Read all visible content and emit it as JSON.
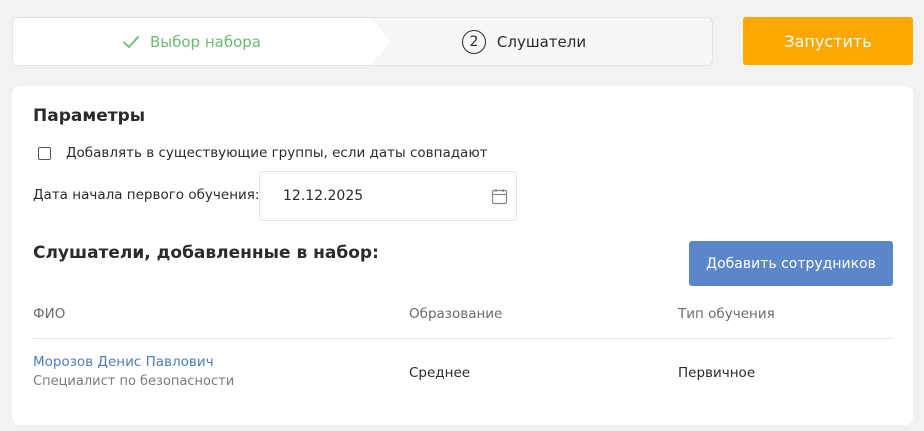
{
  "stepper": {
    "steps": [
      {
        "label": "Выбор набора",
        "state": "done"
      },
      {
        "number": "2",
        "label": "Слушатели",
        "state": "active"
      }
    ]
  },
  "run_button": {
    "label": "Запустить"
  },
  "params": {
    "title": "Параметры",
    "checkbox_label": "Добавлять в существующие группы, если даты совпадают",
    "checkbox_checked": false,
    "date_label": "Дата начала первого обучения:",
    "date_value": "12.12.2025"
  },
  "listeners": {
    "title": "Слушатели, добавленные в набор:",
    "add_button": "Добавить сотрудников",
    "columns": [
      "ФИО",
      "Образование",
      "Тип обучения"
    ],
    "rows": [
      {
        "name": "Морозов Денис Павлович",
        "position": "Специалист по безопасности",
        "education": "Среднее",
        "type": "Первичное"
      }
    ]
  },
  "colors": {
    "accent_orange": "#fda700",
    "button_blue": "#5b86c9",
    "link_blue": "#4f7bbf",
    "done_green": "#6dbb73"
  }
}
